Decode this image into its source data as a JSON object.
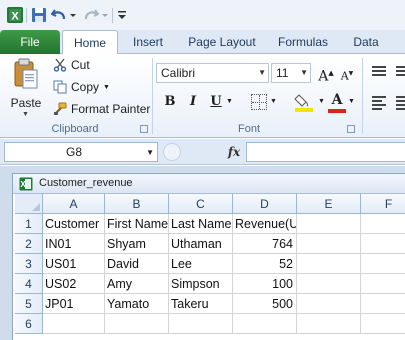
{
  "quick_access": {
    "icons": [
      "excel-icon",
      "save-icon",
      "undo-icon",
      "redo-icon",
      "customize-icon"
    ]
  },
  "tabs": [
    {
      "label": "File"
    },
    {
      "label": "Home"
    },
    {
      "label": "Insert"
    },
    {
      "label": "Page Layout"
    },
    {
      "label": "Formulas"
    },
    {
      "label": "Data"
    }
  ],
  "ribbon": {
    "clipboard": {
      "paste_label": "Paste",
      "cut_label": "Cut",
      "copy_label": "Copy",
      "format_painter_label": "Format Painter",
      "group_label": "Clipboard"
    },
    "font": {
      "font_name": "Calibri",
      "font_size": "11",
      "bold_label": "B",
      "italic_label": "I",
      "underline_label": "U",
      "font_color_label": "A",
      "grow_label": "A",
      "shrink_label": "A",
      "group_label": "Font",
      "colors": {
        "fill": "#f5e400",
        "font": "#e0211c"
      }
    }
  },
  "formula_bar": {
    "name_box": "G8",
    "fx_label": "fx",
    "formula": ""
  },
  "workbook": {
    "title": "Customer_revenue",
    "columns": [
      "A",
      "B",
      "C",
      "D",
      "E",
      "F"
    ],
    "row_numbers": [
      "1",
      "2",
      "3",
      "4",
      "5",
      "6"
    ],
    "rows": [
      [
        "Customer",
        "First Name",
        "Last Name",
        "Revenue(USD)",
        "",
        ""
      ],
      [
        "IN01",
        "Shyam",
        "Uthaman",
        "764",
        "",
        ""
      ],
      [
        "US01",
        "David",
        "Lee",
        "52",
        "",
        ""
      ],
      [
        "US02",
        "Amy",
        "Simpson",
        "100",
        "",
        ""
      ],
      [
        "JP01",
        "Yamato",
        "Takeru",
        "500",
        "",
        ""
      ],
      [
        "",
        "",
        "",
        "",
        "",
        ""
      ]
    ]
  }
}
